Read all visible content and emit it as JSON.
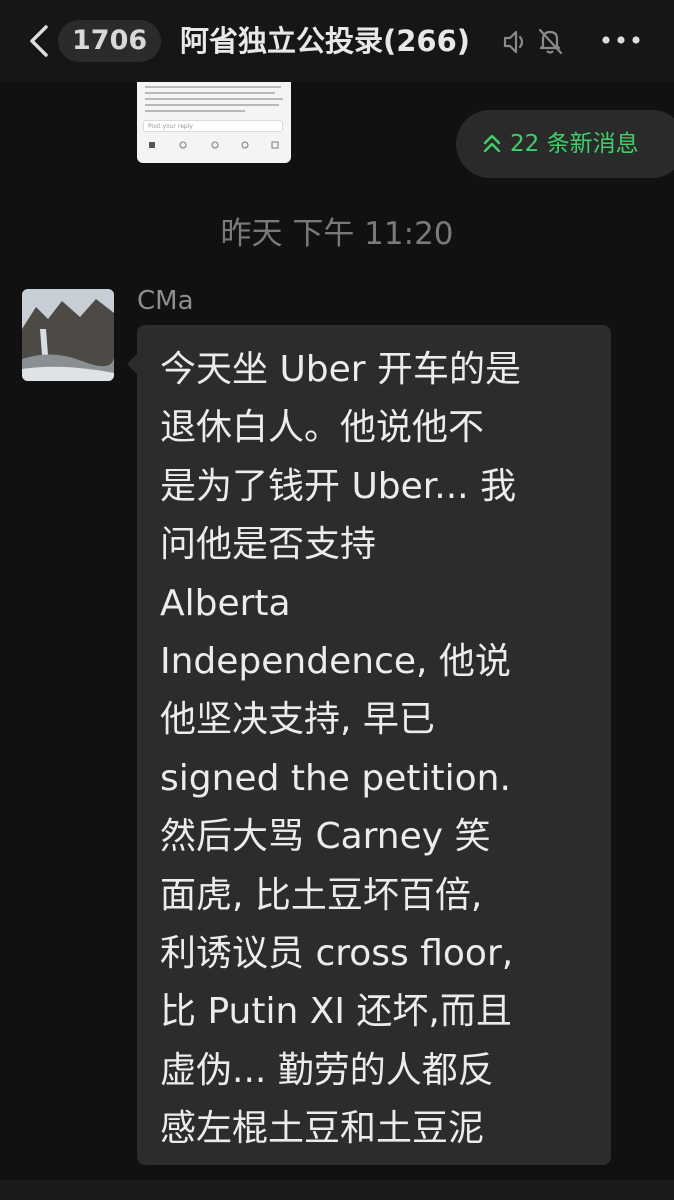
{
  "header": {
    "unread_count": "1706",
    "title": "阿省独立公投录(266)",
    "icons": [
      "back-icon",
      "speaker-off-icon",
      "bell-muted-icon",
      "more-icon"
    ]
  },
  "shared_thumbnail": {
    "reply_placeholder": "Post your reply"
  },
  "new_messages": {
    "label": "22 条新消息",
    "icon": "double-chevron-up-icon",
    "color": "#3ecf6b"
  },
  "timestamp": "昨天 下午 11:20",
  "message": {
    "sender": "CMa",
    "lines": [
      "今天坐 Uber 开车的是",
      "退休白人。他说他不",
      "是为了钱开 Uber... 我",
      "问他是否支持",
      "Alberta",
      "Independence, 他说",
      "他坚决支持, 早已",
      "signed the petition.",
      "然后大骂 Carney 笑",
      "面虎, 比土豆坏百倍,",
      "利诱议员 cross floor,",
      "比 Putin XI 还坏,而且",
      "虚伪... 勤劳的人都反",
      "感左棍土豆和土豆泥"
    ]
  },
  "colors": {
    "background": "#111111",
    "bubble": "#2c2c2c",
    "text": "#ececec",
    "accent_green": "#3ecf6b"
  }
}
